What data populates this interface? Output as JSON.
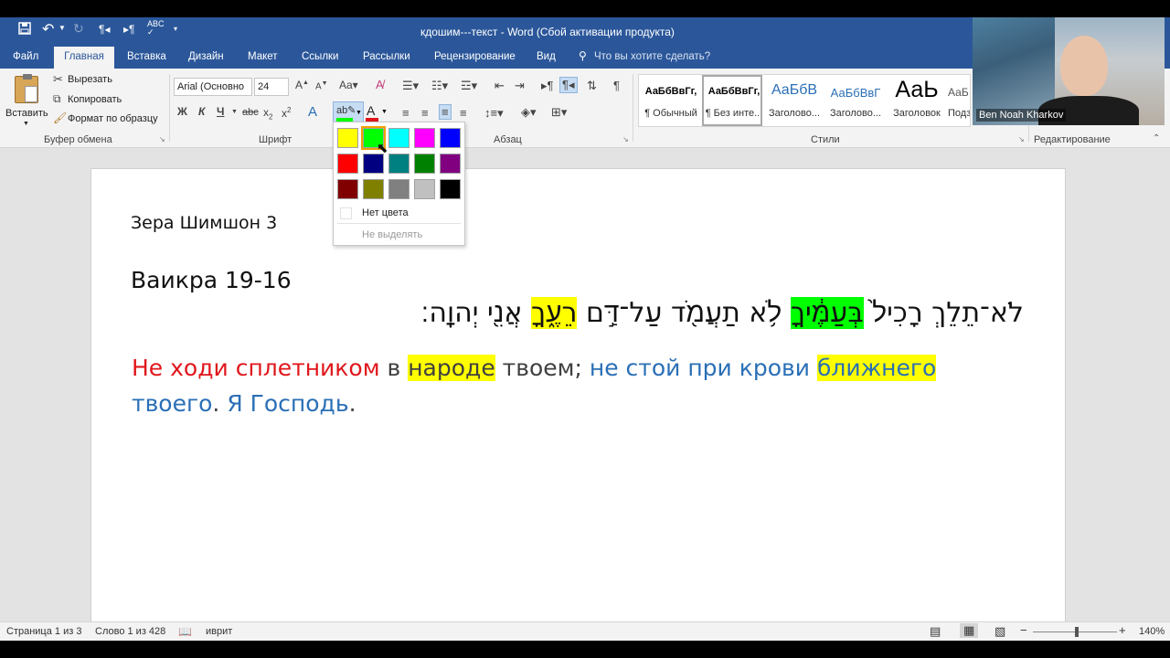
{
  "window": {
    "title": "кдошим---текст - Word (Сбой активации продукта)"
  },
  "tabs": [
    {
      "label": "Файл"
    },
    {
      "label": "Главная"
    },
    {
      "label": "Вставка"
    },
    {
      "label": "Дизайн"
    },
    {
      "label": "Макет"
    },
    {
      "label": "Ссылки"
    },
    {
      "label": "Рассылки"
    },
    {
      "label": "Рецензирование"
    },
    {
      "label": "Вид"
    }
  ],
  "tell_me": "Что вы хотите сделать?",
  "clipboard": {
    "paste": "Вставить",
    "cut": "Вырезать",
    "copy": "Копировать",
    "format_painter": "Формат по образцу",
    "group": "Буфер обмена"
  },
  "font": {
    "name": "Arial (Основно",
    "size": "24",
    "group": "Шрифт",
    "bold": "Ж",
    "italic": "К",
    "underline": "Ч"
  },
  "paragraph": {
    "group": "Абзац"
  },
  "styles": {
    "group": "Стили",
    "items": [
      {
        "sample": "АаБбВвГг,",
        "name": "¶ Обычный"
      },
      {
        "sample": "АаБбВвГг,",
        "name": "¶ Без инте..."
      },
      {
        "sample": "АаБбВ",
        "name": "Заголово..."
      },
      {
        "sample": "АаБбВвГ",
        "name": "Заголово..."
      },
      {
        "sample": "АаЬ",
        "name": "Заголовок"
      },
      {
        "sample": "АаБ",
        "name": "Подз"
      }
    ]
  },
  "editing": {
    "group": "Редактирование"
  },
  "highlight_palette": {
    "colors": [
      "#ffff00",
      "#00ff00",
      "#00ffff",
      "#ff00ff",
      "#0000ff",
      "#ff0000",
      "#000080",
      "#008080",
      "#008000",
      "#800080",
      "#800000",
      "#808000",
      "#808080",
      "#c0c0c0",
      "#000000"
    ],
    "selected_color": "#00ff00",
    "no_color": "Нет цвета",
    "stop_highlighting": "Не выделять"
  },
  "document": {
    "line1": "Зера Шимшон 3",
    "line2": "Ваикра 19-16",
    "hebrew": {
      "part_a": "לֹא־תֵלֵךְ רָכִיל֙ ",
      "part_b": "בְּעַמֶּ֔יךָ",
      "part_c": " לֹ֥א תַעֲמֹ֖ד עַל־דַּ֣ם ",
      "part_d": "רֵעֶ֑ךָ",
      "part_e": " אֲנִ֖י יְהוָֽה׃"
    },
    "russian": {
      "s1": "Не ходи сплетником",
      "s2": " в ",
      "s3": "народе",
      "s4": " твоем; ",
      "s5": "не стой при крови ",
      "s6": "ближнего",
      "s7": " твоего",
      "s8": ". ",
      "s9": "Я Господь",
      "s10": "."
    }
  },
  "webcam": {
    "name": "Ben Noah Kharkov"
  },
  "status": {
    "page": "Страница 1 из 3",
    "words": "Слово 1 из 428",
    "language": "иврит",
    "zoom": "140%"
  }
}
